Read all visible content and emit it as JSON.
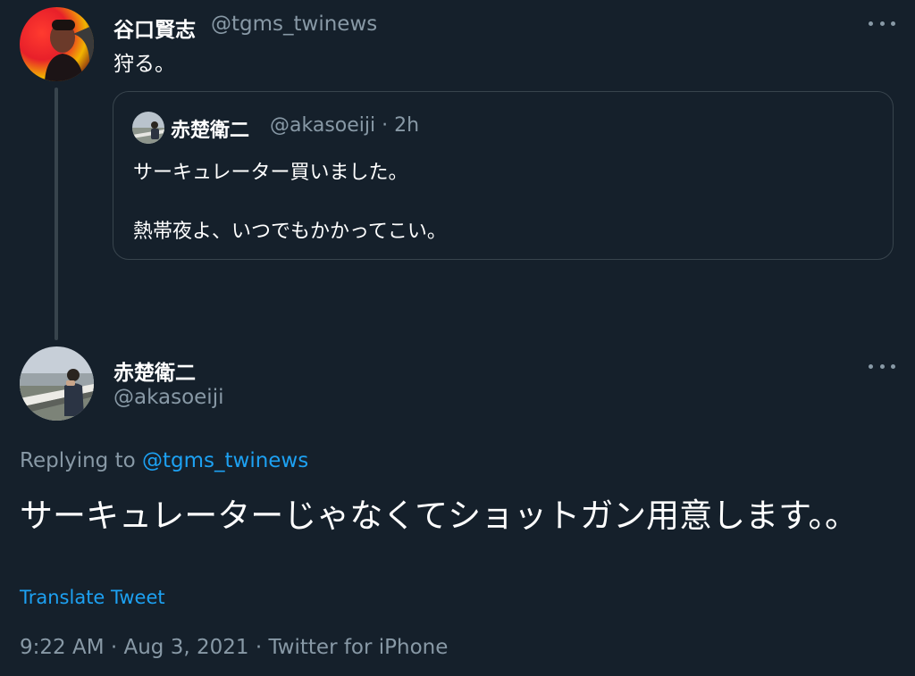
{
  "parent_tweet": {
    "author_name": "谷口賢志",
    "author_handle": "@tgms_twinews",
    "text": "狩る。",
    "more_icon": "more-horizontal-icon"
  },
  "quoted_tweet": {
    "author_name": "赤楚衛二",
    "author_handle": "@akasoeiji",
    "separator": "·",
    "time_ago": "2h",
    "text_line_1": "サーキュレーター買いました。",
    "text_line_2": "熱帯夜よ、いつでもかかってこい。"
  },
  "main_tweet": {
    "author_name": "赤楚衛二",
    "author_handle": "@akasoeiji",
    "replying_prefix": "Replying to",
    "replying_to": "@tgms_twinews",
    "text": "サーキュレーターじゃなくてショットガン用意します。。",
    "translate_label": "Translate Tweet",
    "time": "9:22 AM",
    "separator": "·",
    "date": "Aug 3, 2021",
    "source": "Twitter for iPhone",
    "more_icon": "more-horizontal-icon"
  },
  "colors": {
    "background": "#15202b",
    "border": "#38444d",
    "secondary_text": "#8899a6",
    "link": "#1da1f2",
    "primary_text": "#ffffff"
  }
}
